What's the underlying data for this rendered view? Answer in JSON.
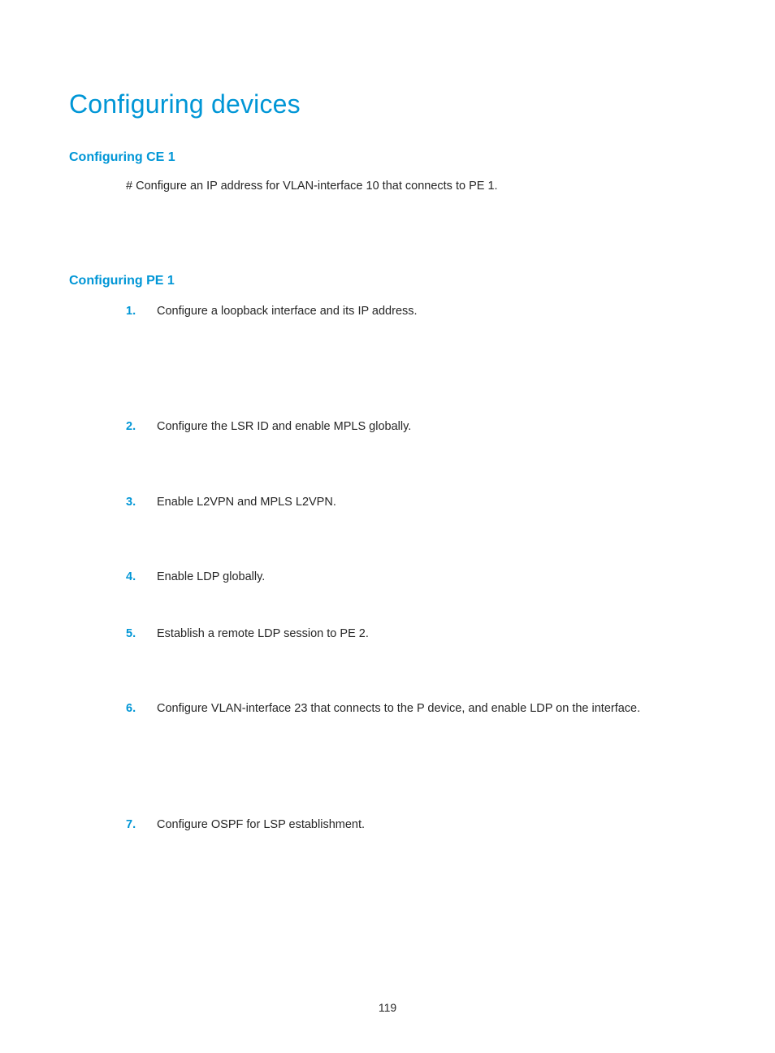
{
  "title": "Configuring devices",
  "section_ce1": {
    "heading": "Configuring CE 1",
    "comment": "# Configure an IP address for VLAN-interface 10 that connects to PE 1."
  },
  "section_pe1": {
    "heading": "Configuring PE 1",
    "items": [
      {
        "num": "1.",
        "text": "Configure a loopback interface and its IP address."
      },
      {
        "num": "2.",
        "text": "Configure the LSR ID and enable MPLS globally."
      },
      {
        "num": "3.",
        "text": "Enable L2VPN and MPLS L2VPN."
      },
      {
        "num": "4.",
        "text": "Enable LDP globally."
      },
      {
        "num": "5.",
        "text": "Establish a remote LDP session to PE 2."
      },
      {
        "num": "6.",
        "text": "Configure VLAN-interface 23 that connects to the P device, and enable LDP on the interface."
      },
      {
        "num": "7.",
        "text": "Configure OSPF for LSP establishment."
      }
    ]
  },
  "page_number": "119"
}
